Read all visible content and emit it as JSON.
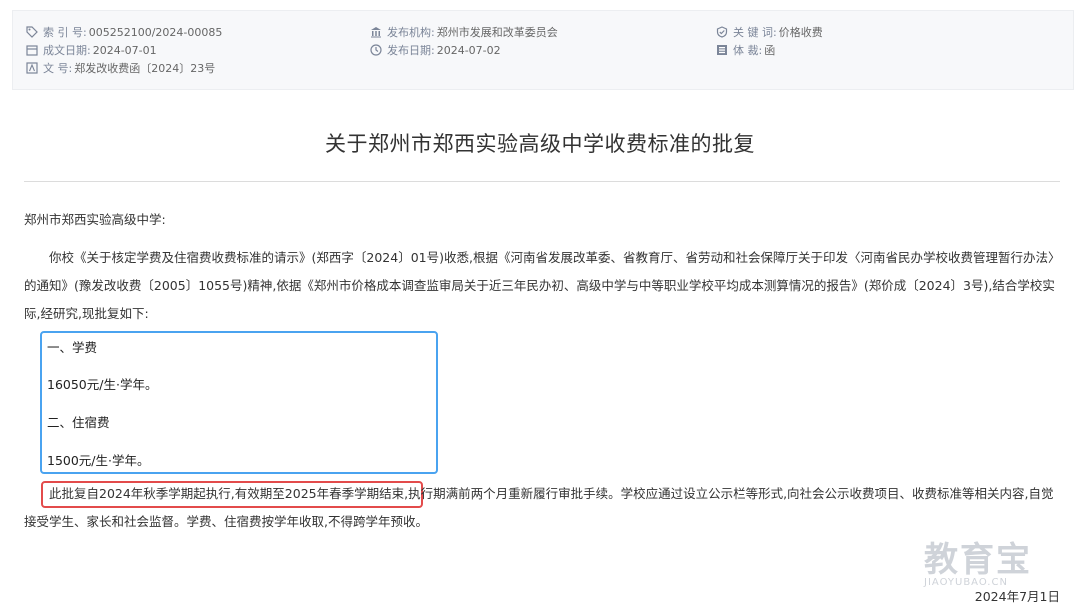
{
  "meta": {
    "index_label": "索  引  号:",
    "index_value": "005252100/2024-00085",
    "org_label": "发布机构:",
    "org_value": "郑州市发展和改革委员会",
    "keyword_label": "关  键  词:",
    "keyword_value": "价格收费",
    "created_label": "成文日期:",
    "created_value": "2024-07-01",
    "published_label": "发布日期:",
    "published_value": "2024-07-02",
    "genre_label": "体        裁:",
    "genre_value": "函",
    "docno_label": "文        号:",
    "docno_value": "郑发改收费函〔2024〕23号"
  },
  "document": {
    "title": "关于郑州市郑西实验高级中学收费标准的批复",
    "addressee": "郑州市郑西实验高级中学:",
    "paragraph1": "你校《关于核定学费及住宿费收费标准的请示》(郑西字〔2024〕01号)收悉,根据《河南省发展改革委、省教育厅、省劳动和社会保障厅关于印发〈河南省民办学校收费管理暂行办法〉的通知》(豫发改收费〔2005〕1055号)精神,依据《郑州市价格成本调查监审局关于近三年民办初、高级中学与中等职业学校平均成本测算情况的报告》(郑价成〔2024〕3号),结合学校实际,经研究,现批复如下:",
    "item1_heading": "一、学费",
    "item1_value": "16050元/生·学年。",
    "item2_heading": "二、住宿费",
    "item2_value": "1500元/生·学年。",
    "paragraph2_highlight": "此批复自2024年秋季学期起执行,有效期至2025年春季学期结束,",
    "paragraph2_rest": "执行期满前两个月重新履行审批手续。学校应通过设立公示栏等形式,向社会公示收费项目、收费标准等相关内容,自觉接受学生、家长和社会监督。学费、住宿费按学年收取,不得跨学年预收。",
    "date": "2024年7月1日"
  },
  "watermark": {
    "main": "教育宝",
    "sub": "JIAOYUBAO.CN"
  },
  "colors": {
    "meta_icon": "#7b8598",
    "blue_box": "#4aa3f0",
    "red_box": "#e34b4b"
  }
}
